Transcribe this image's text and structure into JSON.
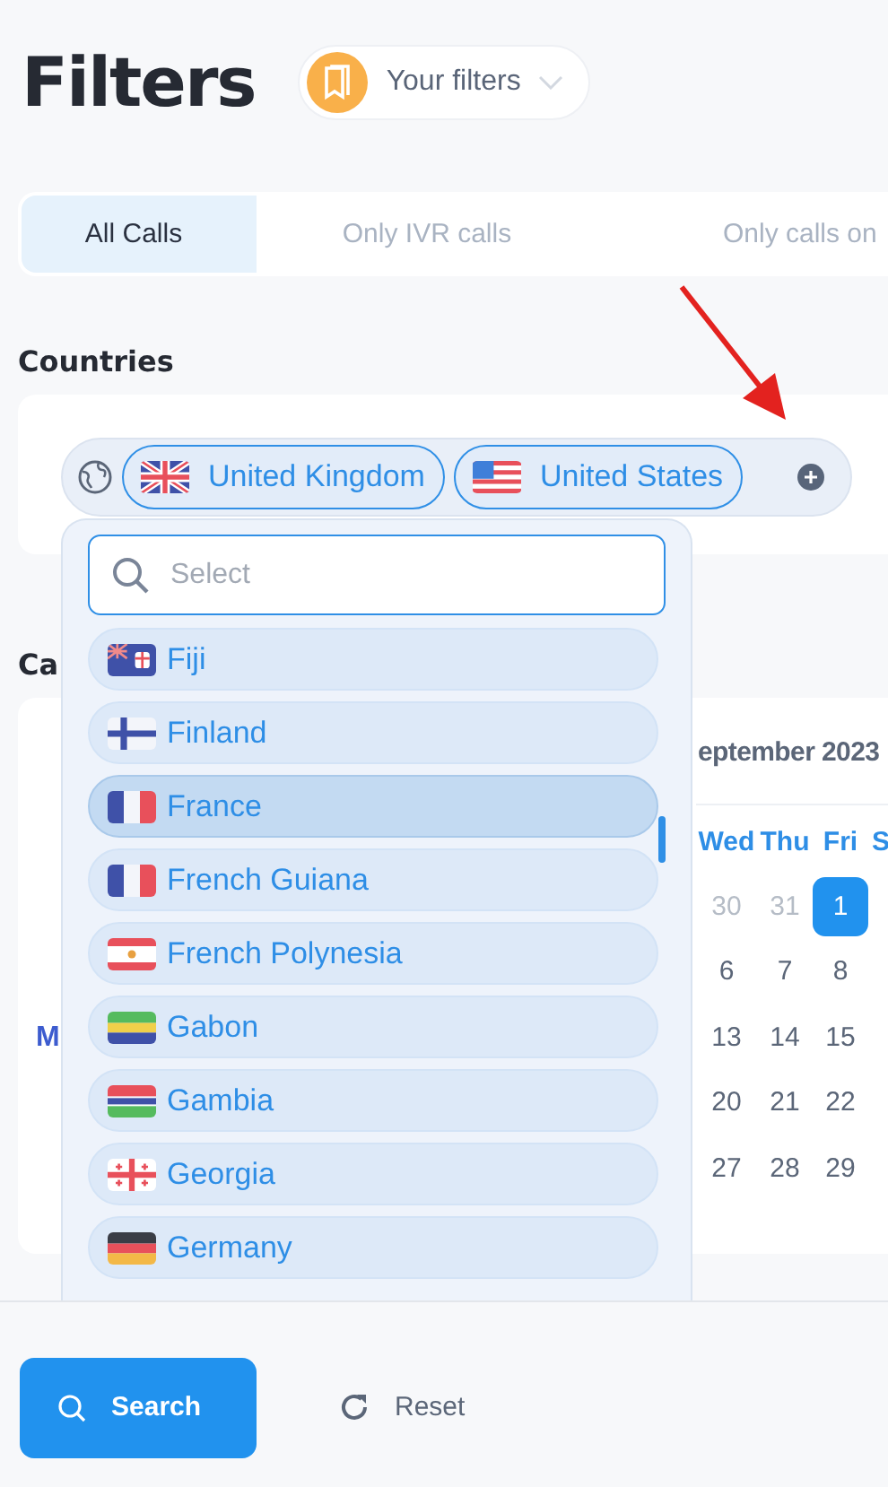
{
  "header": {
    "title": "Filters",
    "saved_filters": {
      "label": "Your filters"
    }
  },
  "tabs": [
    {
      "label": "All Calls",
      "selected": true
    },
    {
      "label": "Only IVR calls",
      "selected": false
    },
    {
      "label": "Only calls on",
      "selected": false
    }
  ],
  "countries": {
    "label": "Countries",
    "chips": [
      {
        "name": "United Kingdom",
        "kind": "gb"
      },
      {
        "name": "United States",
        "kind": "us"
      }
    ],
    "dropdown": {
      "placeholder": "Select",
      "options": [
        {
          "name": "Fiji",
          "kind": "fj",
          "selected": false
        },
        {
          "name": "Finland",
          "kind": "fi",
          "selected": false
        },
        {
          "name": "France",
          "kind": "fr",
          "selected": true
        },
        {
          "name": "French Guiana",
          "kind": "fr",
          "selected": false
        },
        {
          "name": "French Polynesia",
          "kind": "pf",
          "selected": false
        },
        {
          "name": "Gabon",
          "kind": "ga",
          "selected": false
        },
        {
          "name": "Gambia",
          "kind": "gm",
          "selected": false
        },
        {
          "name": "Georgia",
          "kind": "ge",
          "selected": false
        },
        {
          "name": "Germany",
          "kind": "de",
          "selected": false
        }
      ]
    }
  },
  "calendar": {
    "label": "Ca",
    "side_text": "M",
    "month": "eptember 2023",
    "weekdays": [
      "Wed",
      "Thu",
      "Fri",
      "S"
    ],
    "weeks": [
      {
        "days": [
          {
            "day": "30",
            "outside": true,
            "selected": false
          },
          {
            "day": "31",
            "outside": true,
            "selected": false
          },
          {
            "day": "1",
            "outside": false,
            "selected": true
          }
        ]
      },
      {
        "days": [
          {
            "day": "6",
            "outside": false,
            "selected": false
          },
          {
            "day": "7",
            "outside": false,
            "selected": false
          },
          {
            "day": "8",
            "outside": false,
            "selected": false
          }
        ]
      },
      {
        "days": [
          {
            "day": "13",
            "outside": false,
            "selected": false
          },
          {
            "day": "14",
            "outside": false,
            "selected": false
          },
          {
            "day": "15",
            "outside": false,
            "selected": false
          }
        ]
      },
      {
        "days": [
          {
            "day": "20",
            "outside": false,
            "selected": false
          },
          {
            "day": "21",
            "outside": false,
            "selected": false
          },
          {
            "day": "22",
            "outside": false,
            "selected": false
          }
        ]
      },
      {
        "days": [
          {
            "day": "27",
            "outside": false,
            "selected": false
          },
          {
            "day": "28",
            "outside": false,
            "selected": false
          },
          {
            "day": "29",
            "outside": false,
            "selected": false
          }
        ]
      }
    ]
  },
  "footer": {
    "search": "Search",
    "reset": "Reset"
  }
}
